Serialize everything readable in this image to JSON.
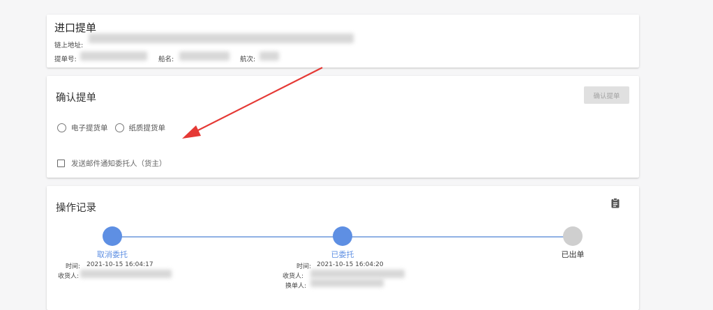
{
  "bill": {
    "title": "进口提单",
    "chain_label": "链上地址:",
    "bill_no_label": "提单号:",
    "ship_name_label": "船名:",
    "voyage_label": "航次:"
  },
  "confirm": {
    "title": "确认提单",
    "button_label": "确认提单",
    "radio_electronic": "电子提货单",
    "radio_paper": "纸质提货单",
    "checkbox_email": "发送邮件通知委托人（货主）"
  },
  "log": {
    "title": "操作记录",
    "steps": [
      {
        "label": "取消委托",
        "status": "done",
        "time_label": "时间:",
        "time": "2021-10-15 16:04:17",
        "consignee_label": "收货人:"
      },
      {
        "label": "已委托",
        "status": "done",
        "time_label": "时间:",
        "time": "2021-10-15 16:04:20",
        "consignee_label": "收货人:",
        "exchanger_label": "换单人:"
      },
      {
        "label": "已出单",
        "status": "pending"
      }
    ]
  },
  "colors": {
    "accent": "#5e8fe3",
    "pending": "#cfcfcf",
    "arrow": "#e53935"
  }
}
